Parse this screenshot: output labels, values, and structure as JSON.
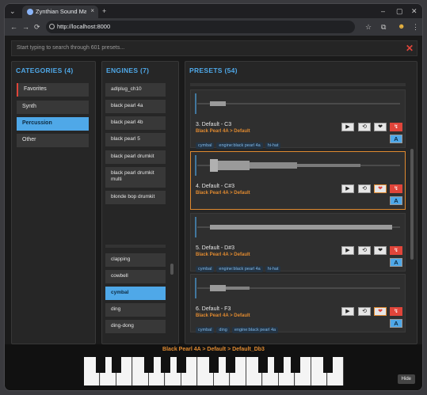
{
  "browser": {
    "tab_title": "Zynthian Sound Mana",
    "tab_close": "×",
    "new_tab": "+",
    "url": "http://localhost:8000"
  },
  "search": {
    "placeholder": "Start typing to search through 601 presets...",
    "close": "✕"
  },
  "categories": {
    "heading": "CATEGORIES (4)",
    "items": [
      "Favorites",
      "Synth",
      "Percussion",
      "Other"
    ],
    "selected": "Percussion"
  },
  "engines": {
    "heading": "ENGINES (7)",
    "items": [
      "adlplug_ch10",
      "black pearl 4a",
      "black pearl 4b",
      "black pearl 5",
      "black pearl drumkit",
      "black pearl drumkit multi",
      "blonde bop drumkit"
    ],
    "tags": [
      "clapping",
      "cowbell",
      "cymbal",
      "ding",
      "ding-dong"
    ],
    "selected_tag": "cymbal"
  },
  "presets": {
    "heading": "PRESETS (54)",
    "items": [
      {
        "name": "3. Default - C3",
        "path": "Black Pearl 4A > Default",
        "tags": [
          "cymbal",
          "engine:black pearl 4a",
          "hi-hat"
        ],
        "active": false,
        "favorite": false
      },
      {
        "name": "4. Default - C#3",
        "path": "Black Pearl 4A > Default",
        "tags": [],
        "active": true,
        "favorite": true
      },
      {
        "name": "5. Default - D#3",
        "path": "Black Pearl 4A > Default",
        "tags": [
          "cymbal",
          "engine:black pearl 4a",
          "hi-hat"
        ],
        "active": false,
        "favorite": false
      },
      {
        "name": "6. Default - F3",
        "path": "Black Pearl 4A > Default",
        "tags": [
          "cymbal",
          "ding",
          "engine:black pearl 4a"
        ],
        "active": false,
        "favorite": true
      }
    ],
    "button_icons": {
      "play": "▶",
      "reset": "⟲",
      "favorite": "❤",
      "edit": "↯",
      "assign": "A"
    }
  },
  "footer": {
    "current_preset": "Black Pearl 4A > Default > Default_Db3",
    "hide_label": "Hide"
  }
}
